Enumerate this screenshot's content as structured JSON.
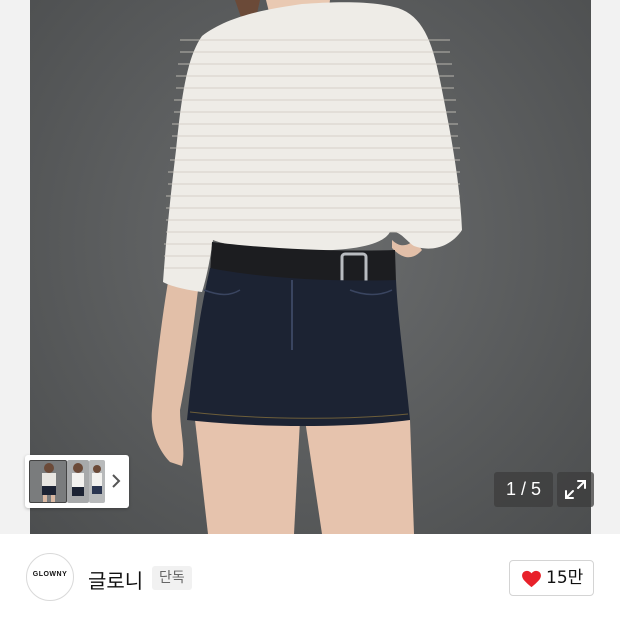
{
  "gallery": {
    "counter_text": "1 / 5",
    "next_icon": "chevron-right-icon",
    "expand_icon": "expand-icon"
  },
  "brand": {
    "logo_text": "GLOWNY",
    "name": "글로니",
    "badge": "단독"
  },
  "like": {
    "icon": "heart-icon",
    "color": "#e8212a",
    "count": "15만"
  }
}
